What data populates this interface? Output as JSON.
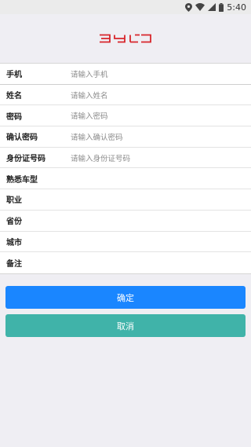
{
  "status_bar": {
    "time": "5:40"
  },
  "brand": {
    "logo_text": "BYD",
    "color": "#d8262b"
  },
  "form": {
    "rows": [
      {
        "label": "手机",
        "placeholder": "请输入手机"
      },
      {
        "label": "姓名",
        "placeholder": "请输入姓名"
      },
      {
        "label": "密码",
        "placeholder": "请输入密码"
      },
      {
        "label": "确认密码",
        "placeholder": "请输入确认密码"
      },
      {
        "label": "身份证号码",
        "placeholder": "请输入身份证号码"
      },
      {
        "label": "熟悉车型",
        "placeholder": ""
      },
      {
        "label": "职业",
        "placeholder": ""
      },
      {
        "label": "省份",
        "placeholder": ""
      },
      {
        "label": "城市",
        "placeholder": ""
      },
      {
        "label": "备注",
        "placeholder": ""
      }
    ]
  },
  "actions": {
    "confirm_label": "确定",
    "cancel_label": "取消"
  },
  "colors": {
    "confirm": "#1a86ff",
    "cancel": "#40b3a9"
  }
}
